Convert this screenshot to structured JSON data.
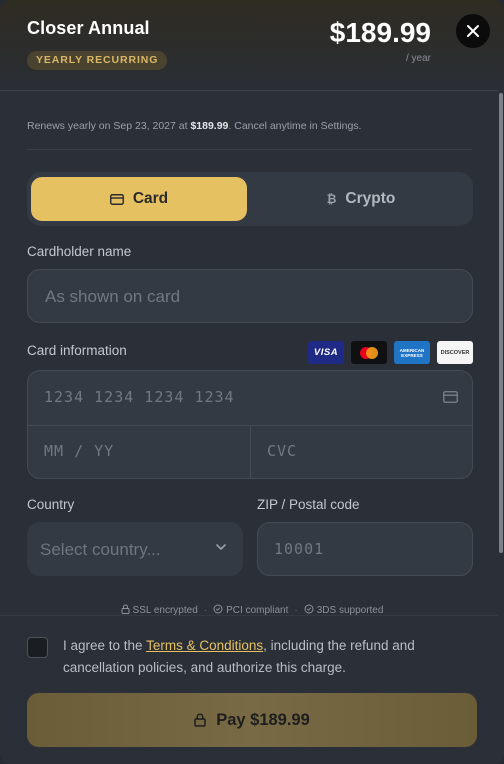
{
  "header": {
    "plan_name": "Closer Annual",
    "badge": "YEARLY RECURRING",
    "price": "$189.99",
    "period": "/ year"
  },
  "renewal": {
    "prefix": "Renews yearly on Sep 23, 2027 at ",
    "amount": "$189.99",
    "suffix": ". Cancel anytime in Settings."
  },
  "tabs": {
    "card": "Card",
    "crypto": "Crypto",
    "crypto_glyph": "₿",
    "selected": "card"
  },
  "form": {
    "cardholder_label": "Cardholder name",
    "cardholder_placeholder": "As shown on card",
    "card_info_label": "Card information",
    "card_number_placeholder": "1234 1234 1234 1234",
    "expiry_placeholder": "MM / YY",
    "cvc_placeholder": "CVC",
    "country_label": "Country",
    "country_placeholder": "Select country...",
    "zip_label": "ZIP / Postal code",
    "zip_placeholder": "10001"
  },
  "card_brands": {
    "visa": "VISA",
    "amex_line1": "AMERICAN",
    "amex_line2": "EXPRESS",
    "discover": "DISCOVER"
  },
  "trust": {
    "ssl": "SSL encrypted",
    "pci": "PCI compliant",
    "threeds": "3DS supported",
    "separator": "·"
  },
  "agreement": {
    "prefix": "I agree to the ",
    "link": "Terms & Conditions",
    "suffix": ", including the refund and cancellation policies, and authorize this charge.",
    "checked": false
  },
  "pay_button": {
    "label": "Pay $189.99"
  },
  "colors": {
    "accent": "#e6c162",
    "background": "#2b3038",
    "field": "#343a44"
  }
}
